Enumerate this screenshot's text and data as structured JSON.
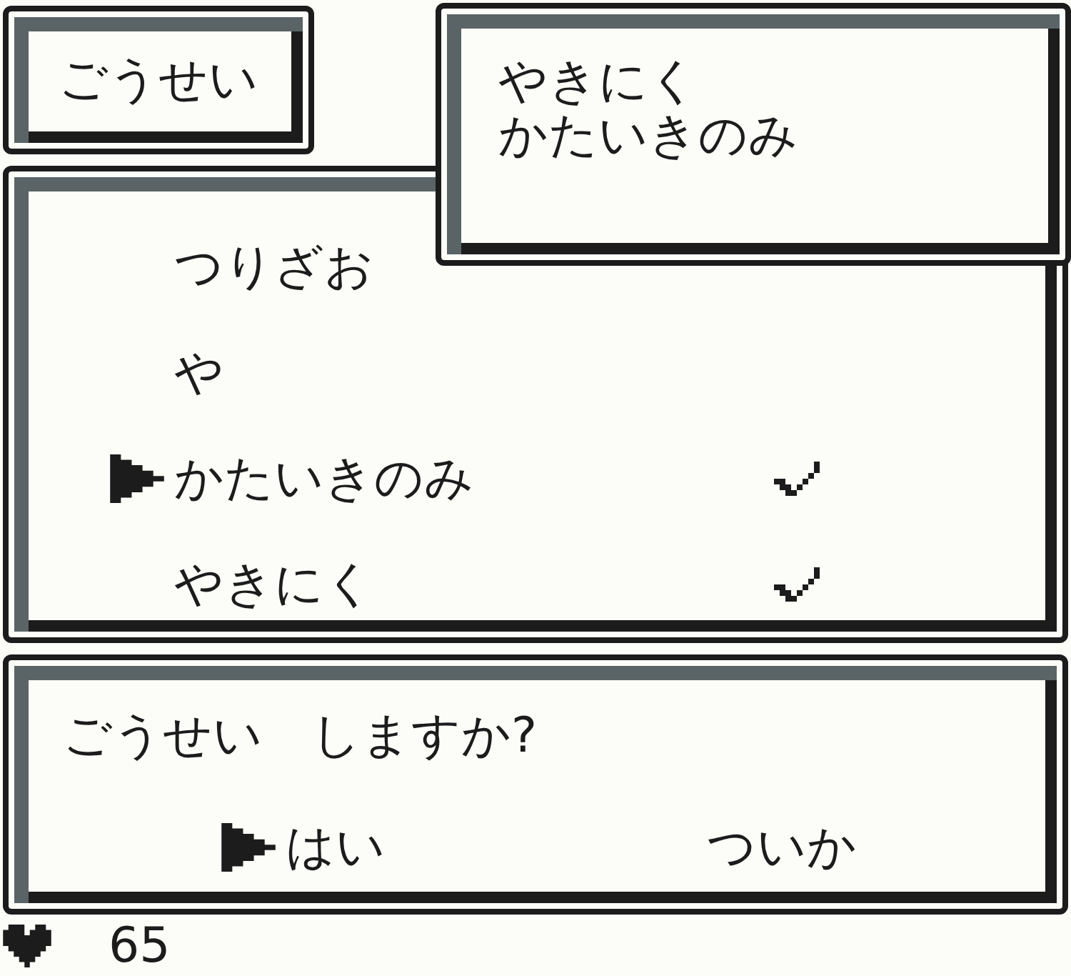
{
  "menu_title": "ごうせい",
  "info_panel": {
    "lines": [
      "やきにく",
      "かたいきのみ"
    ]
  },
  "items": [
    {
      "label": "つりざお",
      "selected": false,
      "checked": false
    },
    {
      "label": "や",
      "selected": false,
      "checked": false
    },
    {
      "label": "かたいきのみ",
      "selected": true,
      "checked": true
    },
    {
      "label": "やきにく",
      "selected": false,
      "checked": true
    }
  ],
  "dialog": {
    "prompt": "ごうせい　しますか?",
    "choices": [
      {
        "label": "はい",
        "selected": true
      },
      {
        "label": "ついか",
        "selected": false
      }
    ]
  },
  "status_bar": {
    "hp": "65"
  }
}
